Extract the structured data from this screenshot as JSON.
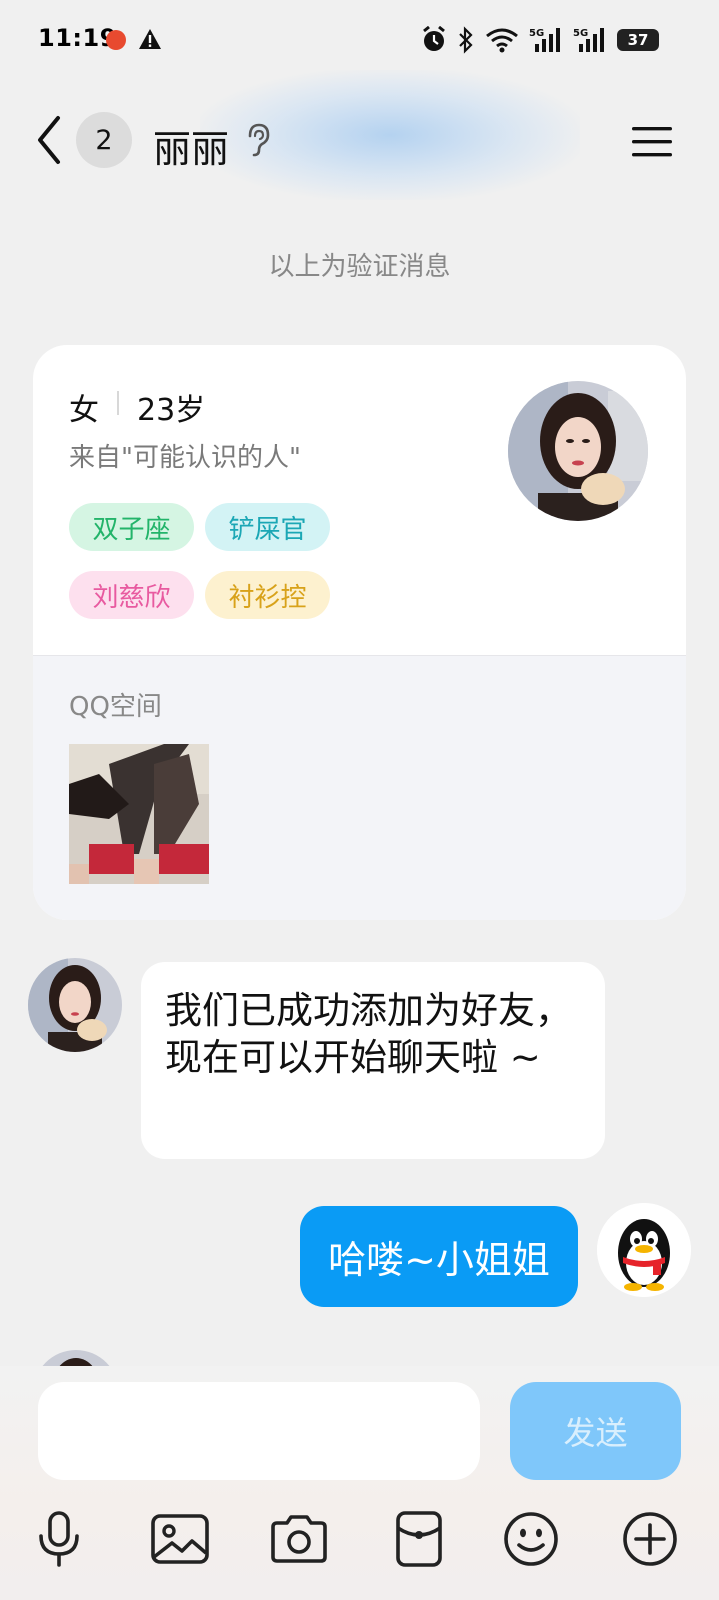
{
  "status_bar": {
    "time": "11:19",
    "battery": "37",
    "icons": [
      "app-notification-icon",
      "warning-icon",
      "alarm-icon",
      "bluetooth-icon",
      "wifi-icon",
      "signal-5g-icon",
      "signal-5g-icon",
      "battery-icon"
    ]
  },
  "header": {
    "unread_count": "2",
    "title": "丽丽",
    "icons": [
      "back-chevron-icon",
      "ear-icon",
      "menu-icon"
    ]
  },
  "verification_note": "以上为验证消息",
  "profile_card": {
    "gender": "女",
    "age": "23岁",
    "source": "来自\"可能认识的人\"",
    "tags": [
      {
        "label": "双子座",
        "color": "#23b46a"
      },
      {
        "label": "铲屎官",
        "color": "#1ba7b5"
      },
      {
        "label": "刘慈欣",
        "color": "#e85aa0"
      },
      {
        "label": "衬衫控",
        "color": "#d8a21a"
      }
    ],
    "qzone_label": "QQ空间"
  },
  "messages": [
    {
      "from": "contact",
      "text": "我们已成功添加为好友，现在可以开始聊天啦 ~"
    },
    {
      "from": "me",
      "text": "哈喽~小姐姐"
    }
  ],
  "composer": {
    "input_value": "",
    "send_label": "发送",
    "toolbar_icons": [
      "microphone-icon",
      "image-icon",
      "camera-icon",
      "red-packet-icon",
      "emoji-icon",
      "plus-icon"
    ]
  },
  "colors": {
    "accent_blue": "#0a9bf5",
    "send_disabled": "#7fc7fa",
    "background": "#f0f0f0"
  }
}
